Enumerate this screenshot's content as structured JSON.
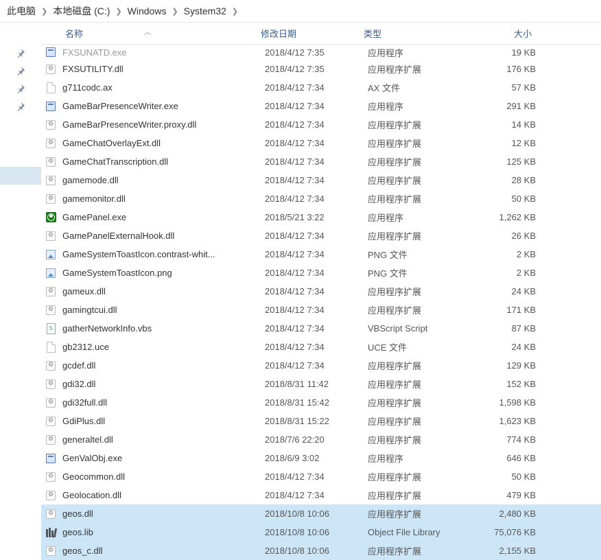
{
  "breadcrumb": [
    "此电脑",
    "本地磁盘 (C:)",
    "Windows",
    "System32"
  ],
  "columns": {
    "name": "名称",
    "date": "修改日期",
    "type": "类型",
    "size": "大小"
  },
  "cut_row": {
    "name": "FXSUNATD.exe",
    "date": "2018/4/12 7:35",
    "type": "应用程序",
    "size": "19 KB"
  },
  "rows": [
    {
      "icon": "gear",
      "name": "FXSUTILITY.dll",
      "date": "2018/4/12 7:35",
      "type": "应用程序扩展",
      "size": "176 KB"
    },
    {
      "icon": "file",
      "name": "g711codc.ax",
      "date": "2018/4/12 7:34",
      "type": "AX 文件",
      "size": "57 KB"
    },
    {
      "icon": "exe",
      "name": "GameBarPresenceWriter.exe",
      "date": "2018/4/12 7:34",
      "type": "应用程序",
      "size": "291 KB"
    },
    {
      "icon": "gear",
      "name": "GameBarPresenceWriter.proxy.dll",
      "date": "2018/4/12 7:34",
      "type": "应用程序扩展",
      "size": "14 KB"
    },
    {
      "icon": "gear",
      "name": "GameChatOverlayExt.dll",
      "date": "2018/4/12 7:34",
      "type": "应用程序扩展",
      "size": "12 KB"
    },
    {
      "icon": "gear",
      "name": "GameChatTranscription.dll",
      "date": "2018/4/12 7:34",
      "type": "应用程序扩展",
      "size": "125 KB"
    },
    {
      "icon": "gear",
      "name": "gamemode.dll",
      "date": "2018/4/12 7:34",
      "type": "应用程序扩展",
      "size": "28 KB"
    },
    {
      "icon": "gear",
      "name": "gamemonitor.dll",
      "date": "2018/4/12 7:34",
      "type": "应用程序扩展",
      "size": "50 KB"
    },
    {
      "icon": "xbox",
      "name": "GamePanel.exe",
      "date": "2018/5/21 3:22",
      "type": "应用程序",
      "size": "1,262 KB"
    },
    {
      "icon": "gear",
      "name": "GamePanelExternalHook.dll",
      "date": "2018/4/12 7:34",
      "type": "应用程序扩展",
      "size": "26 KB"
    },
    {
      "icon": "png",
      "name": "GameSystemToastIcon.contrast-whit...",
      "date": "2018/4/12 7:34",
      "type": "PNG 文件",
      "size": "2 KB"
    },
    {
      "icon": "png",
      "name": "GameSystemToastIcon.png",
      "date": "2018/4/12 7:34",
      "type": "PNG 文件",
      "size": "2 KB"
    },
    {
      "icon": "gear",
      "name": "gameux.dll",
      "date": "2018/4/12 7:34",
      "type": "应用程序扩展",
      "size": "24 KB"
    },
    {
      "icon": "gear",
      "name": "gamingtcui.dll",
      "date": "2018/4/12 7:34",
      "type": "应用程序扩展",
      "size": "171 KB"
    },
    {
      "icon": "vbs",
      "name": "gatherNetworkInfo.vbs",
      "date": "2018/4/12 7:34",
      "type": "VBScript Script",
      "size": "87 KB"
    },
    {
      "icon": "file",
      "name": "gb2312.uce",
      "date": "2018/4/12 7:34",
      "type": "UCE 文件",
      "size": "24 KB"
    },
    {
      "icon": "gear",
      "name": "gcdef.dll",
      "date": "2018/4/12 7:34",
      "type": "应用程序扩展",
      "size": "129 KB"
    },
    {
      "icon": "gear",
      "name": "gdi32.dll",
      "date": "2018/8/31 11:42",
      "type": "应用程序扩展",
      "size": "152 KB"
    },
    {
      "icon": "gear",
      "name": "gdi32full.dll",
      "date": "2018/8/31 15:42",
      "type": "应用程序扩展",
      "size": "1,598 KB"
    },
    {
      "icon": "gear",
      "name": "GdiPlus.dll",
      "date": "2018/8/31 15:22",
      "type": "应用程序扩展",
      "size": "1,623 KB"
    },
    {
      "icon": "gear",
      "name": "generaltel.dll",
      "date": "2018/7/6 22:20",
      "type": "应用程序扩展",
      "size": "774 KB"
    },
    {
      "icon": "exe",
      "name": "GenValObj.exe",
      "date": "2018/6/9 3:02",
      "type": "应用程序",
      "size": "646 KB"
    },
    {
      "icon": "gear",
      "name": "Geocommon.dll",
      "date": "2018/4/12 7:34",
      "type": "应用程序扩展",
      "size": "50 KB"
    },
    {
      "icon": "gear",
      "name": "Geolocation.dll",
      "date": "2018/4/12 7:34",
      "type": "应用程序扩展",
      "size": "479 KB"
    },
    {
      "icon": "gear",
      "name": "geos.dll",
      "date": "2018/10/8 10:06",
      "type": "应用程序扩展",
      "size": "2,480 KB",
      "selected": true
    },
    {
      "icon": "lib",
      "name": "geos.lib",
      "date": "2018/10/8 10:06",
      "type": "Object File Library",
      "size": "75,076 KB",
      "selected": true
    },
    {
      "icon": "gear",
      "name": "geos_c.dll",
      "date": "2018/10/8 10:06",
      "type": "应用程序扩展",
      "size": "2,155 KB",
      "selected": true
    }
  ]
}
